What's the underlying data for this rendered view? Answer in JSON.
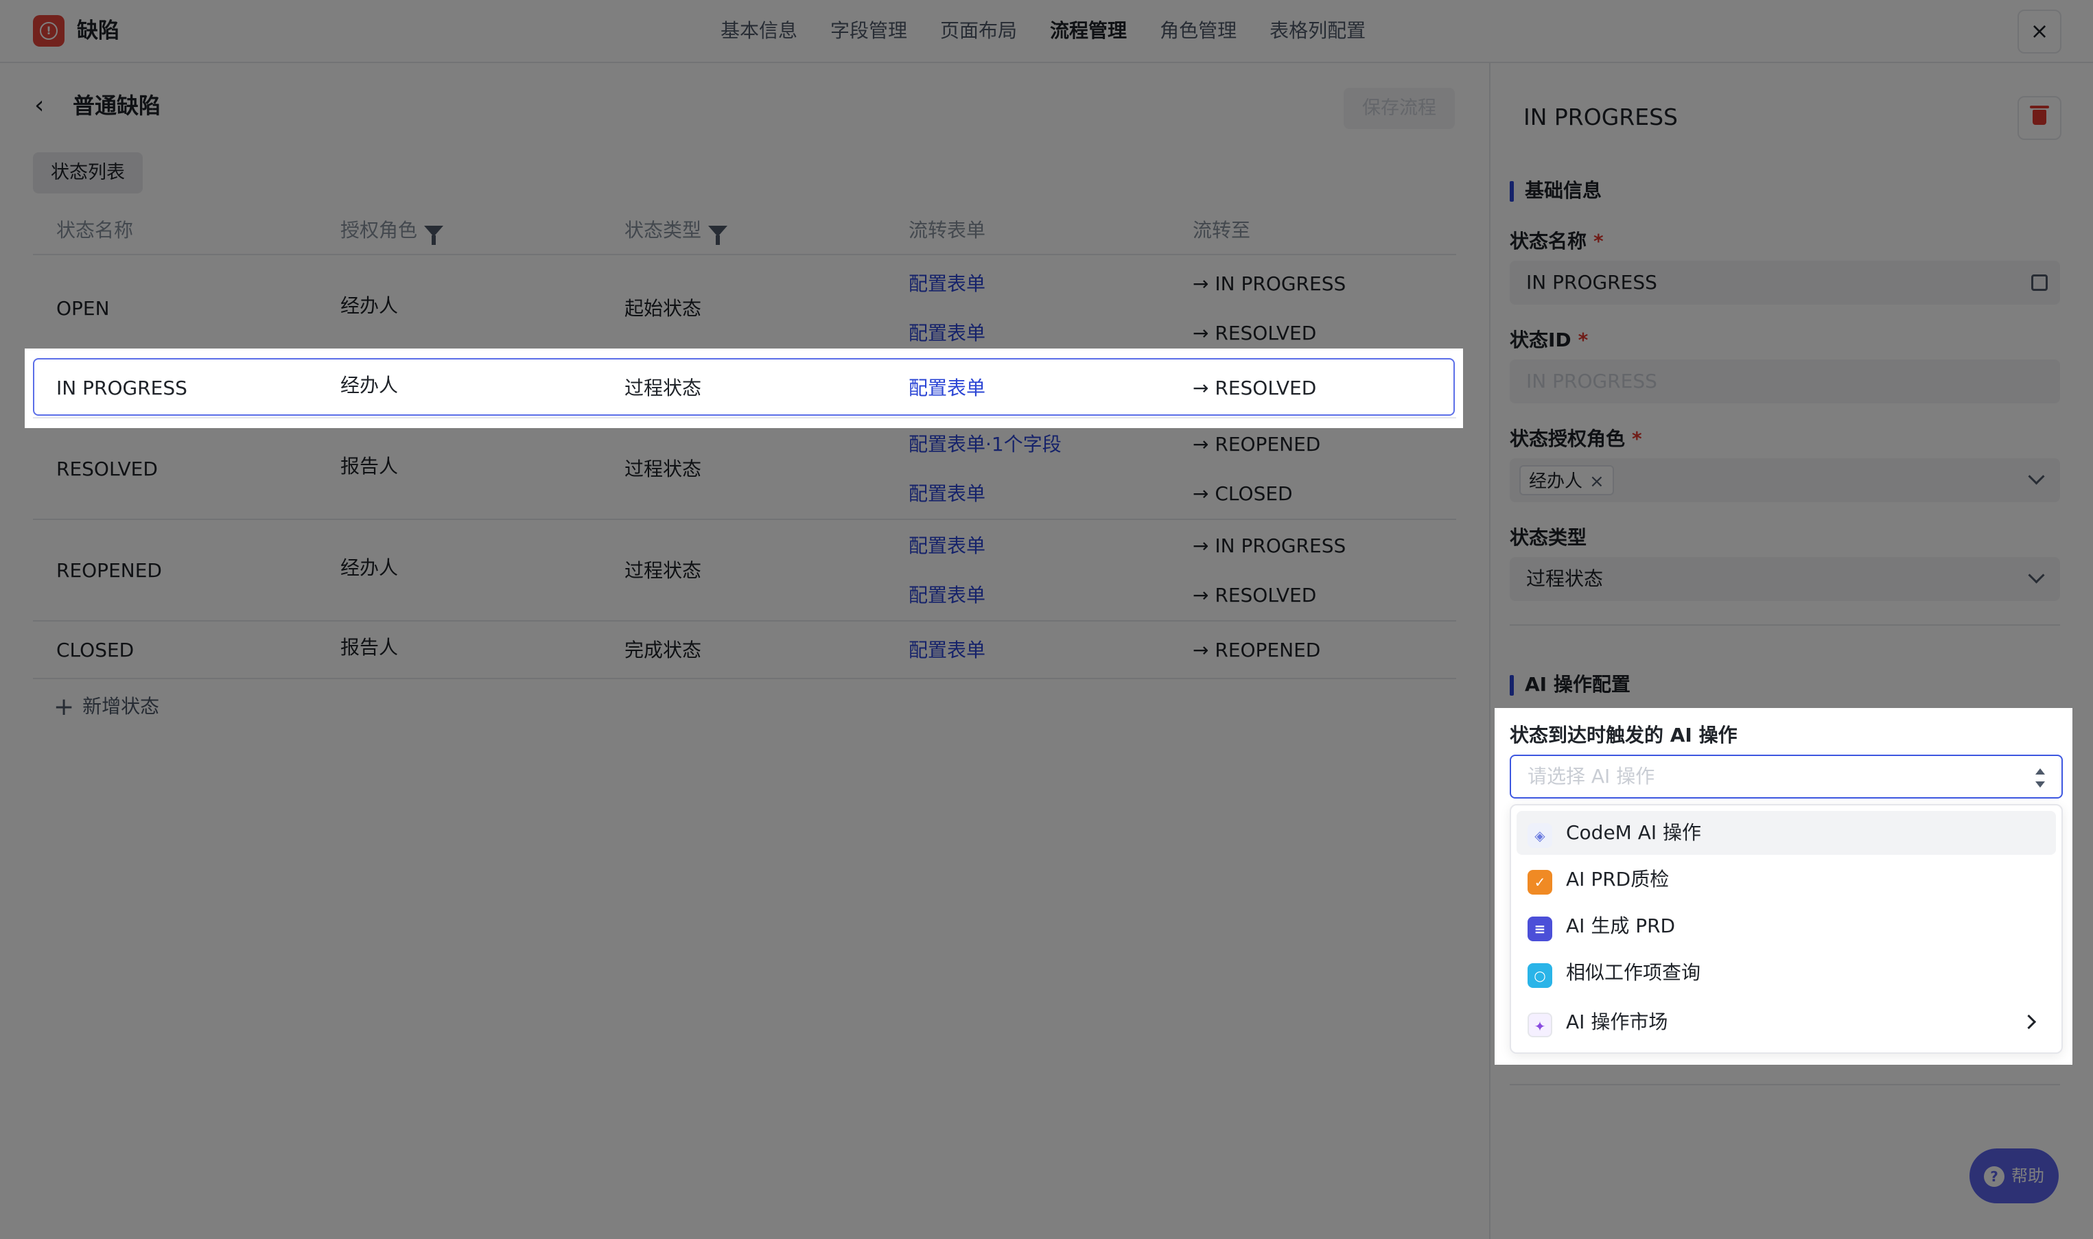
{
  "app": {
    "title": "缺陷"
  },
  "nav": [
    "基本信息",
    "字段管理",
    "页面布局",
    "流程管理",
    "角色管理",
    "表格列配置"
  ],
  "left": {
    "title": "普通缺陷",
    "save_label": "保存流程",
    "tab_label": "状态列表",
    "columns": [
      "状态名称",
      "授权角色",
      "状态类型",
      "流转表单",
      "流转至"
    ],
    "rows": [
      {
        "name": "OPEN",
        "role": "经办人",
        "type": "起始状态",
        "transitions": [
          {
            "form": "配置表单",
            "to": "IN PROGRESS"
          },
          {
            "form": "配置表单",
            "to": "RESOLVED"
          }
        ]
      },
      {
        "name": "IN PROGRESS",
        "role": "经办人",
        "type": "过程状态",
        "transitions": [
          {
            "form": "配置表单",
            "to": "RESOLVED"
          }
        ]
      },
      {
        "name": "RESOLVED",
        "role": "报告人",
        "type": "过程状态",
        "transitions": [
          {
            "form": "配置表单·1个字段",
            "to": "REOPENED"
          },
          {
            "form": "配置表单",
            "to": "CLOSED"
          }
        ]
      },
      {
        "name": "REOPENED",
        "role": "经办人",
        "type": "过程状态",
        "transitions": [
          {
            "form": "配置表单",
            "to": "IN PROGRESS"
          },
          {
            "form": "配置表单",
            "to": "RESOLVED"
          }
        ]
      },
      {
        "name": "CLOSED",
        "role": "报告人",
        "type": "完成状态",
        "transitions": [
          {
            "form": "配置表单",
            "to": "REOPENED"
          }
        ]
      }
    ],
    "add_state_label": "新增状态"
  },
  "right": {
    "title": "IN PROGRESS",
    "basic_section": "基础信息",
    "state_name_label": "状态名称",
    "state_name_value": "IN PROGRESS",
    "state_id_label": "状态ID",
    "state_id_value": "IN PROGRESS",
    "role_label": "状态授权角色",
    "role_tag": "经办人",
    "type_label": "状态类型",
    "type_value": "过程状态",
    "ai_section": "AI 操作配置",
    "ai_trigger_label": "状态到达时触发的 AI 操作",
    "ai_placeholder": "请选择 AI 操作",
    "ai_options": [
      "CodeM AI 操作",
      "AI PRD质检",
      "AI 生成 PRD",
      "相似工作项查询",
      "AI 操作市场"
    ]
  },
  "help_label": "帮助",
  "colors": {
    "accent": "#2b45d4",
    "danger": "#e0392f",
    "help": "#5a63e8"
  },
  "icons": [
    "app-logo-icon",
    "close-icon",
    "back-arrow-icon",
    "filter-icon",
    "arrow-right-icon",
    "plus-icon",
    "trash-icon",
    "edit-icon",
    "chevron-down-icon",
    "sort-icon",
    "codem-icon",
    "prd-check-icon",
    "prd-generate-icon",
    "search-similar-icon",
    "sparkle-icon",
    "chevron-right-icon",
    "help-icon"
  ]
}
